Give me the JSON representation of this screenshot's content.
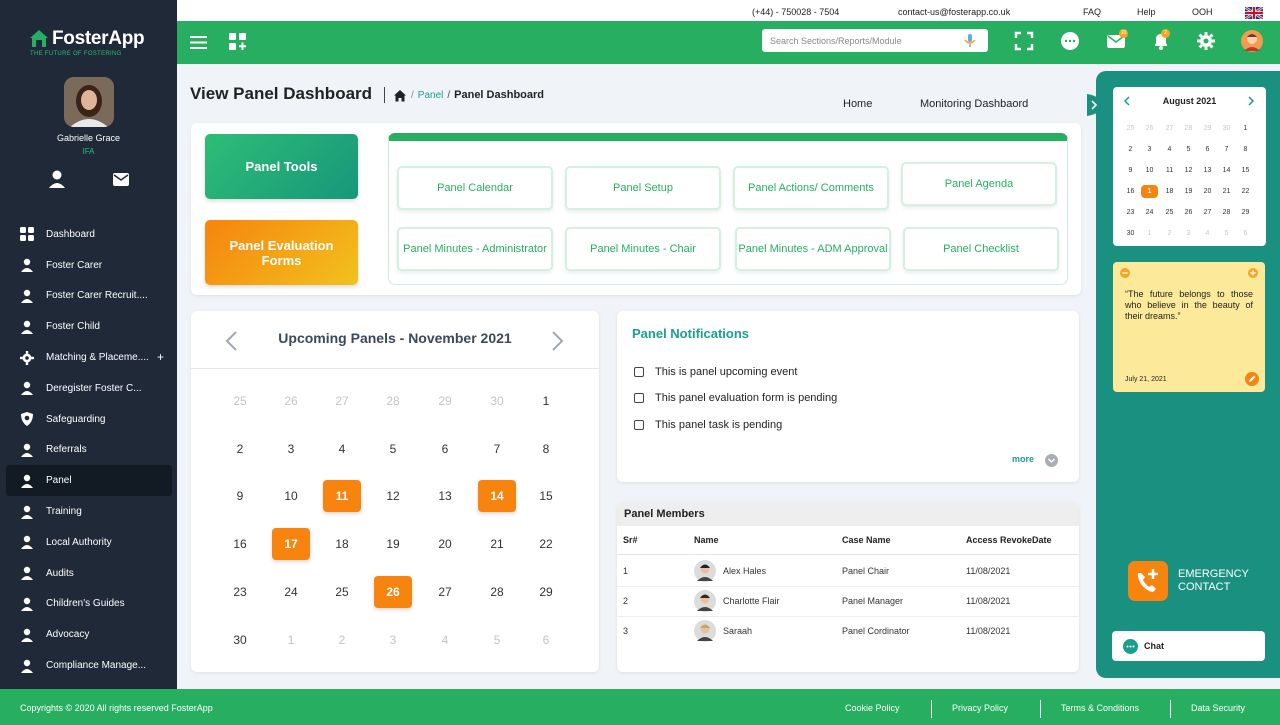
{
  "brand": {
    "name": "FosterApp",
    "tagline": "THE FUTURE OF FOSTERING"
  },
  "profile": {
    "name": "Gabrielle Grace",
    "role": "IFA"
  },
  "nav": [
    {
      "label": "Dashboard",
      "icon": "dashboard-icon"
    },
    {
      "label": "Foster Carer",
      "icon": "foster-carer-icon"
    },
    {
      "label": "Foster Carer Recruit....",
      "icon": "recruit-search-icon"
    },
    {
      "label": "Foster Child",
      "icon": "foster-child-icon"
    },
    {
      "label": "Matching & Placeme....",
      "icon": "matching-gear-icon",
      "plus": "+"
    },
    {
      "label": "Deregister Foster C...",
      "icon": "deregister-icon"
    },
    {
      "label": "Safeguarding",
      "icon": "shield-icon"
    },
    {
      "label": "Referrals",
      "icon": "referrals-icon"
    },
    {
      "label": "Panel",
      "icon": "panel-icon",
      "active": true
    },
    {
      "label": "Training",
      "icon": "training-icon"
    },
    {
      "label": "Local Authority",
      "icon": "local-authority-icon"
    },
    {
      "label": "Audits",
      "icon": "audits-icon"
    },
    {
      "label": "Children's Guides",
      "icon": "guides-icon"
    },
    {
      "label": "Advocacy",
      "icon": "advocacy-icon"
    },
    {
      "label": "Compliance Manage...",
      "icon": "compliance-icon"
    }
  ],
  "contact": {
    "phone": "(+44) - 750028 - 7504",
    "email": "contact-us@fosterapp.co.uk",
    "faq": "FAQ",
    "help": "Help",
    "ooh": "OOH"
  },
  "search": {
    "placeholder": "Search Sections/Reports/Module"
  },
  "badges": {
    "mail": "10",
    "bell": "2"
  },
  "page": {
    "title": "View Panel Dashboard",
    "crumb_link": "Panel",
    "crumb_current": "Panel Dashboard",
    "home_link": "Home",
    "monitoring_link": "Monitoring Dashbaord"
  },
  "panel_tools": {
    "tools_button": "Panel Tools",
    "eval_button": "Panel Evaluation Forms",
    "items": [
      "Panel Calendar",
      "Panel Setup",
      "Panel Actions/ Comments",
      "Panel Agenda",
      "Panel Minutes - Administrator",
      "Panel Minutes - Chair",
      "Panel Minutes - ADM Approval",
      "Panel Checklist"
    ]
  },
  "upcoming": {
    "title": "Upcoming Panels - November 2021",
    "weeks": [
      [
        [
          "25",
          1
        ],
        [
          "26",
          1
        ],
        [
          "27",
          1
        ],
        [
          "28",
          1
        ],
        [
          "29",
          1
        ],
        [
          "30",
          1
        ],
        [
          "1",
          0
        ]
      ],
      [
        [
          "2",
          0
        ],
        [
          "3",
          0
        ],
        [
          "4",
          0
        ],
        [
          "5",
          0
        ],
        [
          "6",
          0
        ],
        [
          "7",
          0
        ],
        [
          "8",
          0
        ]
      ],
      [
        [
          "9",
          0
        ],
        [
          "10",
          0
        ],
        [
          "11",
          2
        ],
        [
          "12",
          0
        ],
        [
          "13",
          0
        ],
        [
          "14",
          2
        ],
        [
          "15",
          0
        ]
      ],
      [
        [
          "16",
          0
        ],
        [
          "17",
          2
        ],
        [
          "18",
          0
        ],
        [
          "19",
          0
        ],
        [
          "20",
          0
        ],
        [
          "21",
          0
        ],
        [
          "22",
          0
        ]
      ],
      [
        [
          "23",
          0
        ],
        [
          "24",
          0
        ],
        [
          "25",
          0
        ],
        [
          "26",
          2
        ],
        [
          "27",
          0
        ],
        [
          "28",
          0
        ],
        [
          "29",
          0
        ]
      ],
      [
        [
          "30",
          0
        ],
        [
          "1",
          1
        ],
        [
          "2",
          1
        ],
        [
          "3",
          1
        ],
        [
          "4",
          1
        ],
        [
          "5",
          1
        ],
        [
          "6",
          1
        ]
      ]
    ]
  },
  "notifications": {
    "title": "Panel Notifications",
    "items": [
      "This is panel upcoming event",
      "This panel evaluation form is pending",
      "This panel task is pending"
    ],
    "more": "more"
  },
  "members": {
    "title": "Panel Members",
    "headers": [
      "Sr#",
      "Name",
      "Case Name",
      "Access RevokeDate"
    ],
    "rows": [
      {
        "sr": "1",
        "name": "Alex Hales",
        "case": "Panel Chair",
        "date": "11/08/2021"
      },
      {
        "sr": "2",
        "name": "Charlotte Flair",
        "case": "Panel Manager",
        "date": "11/08/2021"
      },
      {
        "sr": "3",
        "name": "Saraah",
        "case": "Panel Cordinator",
        "date": "11/08/2021"
      }
    ]
  },
  "mini_calendar": {
    "title": "August 2021",
    "weeks": [
      [
        [
          "25",
          1
        ],
        [
          "26",
          1
        ],
        [
          "27",
          1
        ],
        [
          "28",
          1
        ],
        [
          "29",
          1
        ],
        [
          "30",
          1
        ],
        [
          "1",
          0
        ]
      ],
      [
        [
          "2",
          0
        ],
        [
          "3",
          0
        ],
        [
          "4",
          0
        ],
        [
          "5",
          0
        ],
        [
          "6",
          0
        ],
        [
          "7",
          0
        ],
        [
          "8",
          0
        ]
      ],
      [
        [
          "9",
          0
        ],
        [
          "10",
          0
        ],
        [
          "11",
          0
        ],
        [
          "12",
          0
        ],
        [
          "13",
          0
        ],
        [
          "14",
          0
        ],
        [
          "15",
          0
        ]
      ],
      [
        [
          "16",
          0
        ],
        [
          "1",
          2
        ],
        [
          "18",
          0
        ],
        [
          "19",
          0
        ],
        [
          "20",
          0
        ],
        [
          "21",
          0
        ],
        [
          "22",
          0
        ]
      ],
      [
        [
          "23",
          0
        ],
        [
          "24",
          0
        ],
        [
          "25",
          0
        ],
        [
          "26",
          0
        ],
        [
          "27",
          0
        ],
        [
          "28",
          0
        ],
        [
          "29",
          0
        ]
      ],
      [
        [
          "30",
          0
        ],
        [
          "1",
          1
        ],
        [
          "2",
          1
        ],
        [
          "3",
          1
        ],
        [
          "4",
          1
        ],
        [
          "5",
          1
        ],
        [
          "6",
          1
        ]
      ]
    ]
  },
  "quote": {
    "text": "“The future belongs to those who believe in the beauty of their dreams.”",
    "date": "July 21, 2021"
  },
  "emergency": {
    "label": "EMERGENCY CONTACT"
  },
  "chat": {
    "label": "Chat"
  },
  "footer": {
    "copyright": "Copyrights © 2020  All rights reserved FosterApp",
    "links": [
      "Cookie Policy",
      "Privacy Policy",
      "Terms & Conditions",
      "Data Security"
    ]
  },
  "colors": {
    "green": "#27ae60",
    "orange": "#f6840f",
    "teal": "#1a9081",
    "sidebar": "#1f2937"
  }
}
